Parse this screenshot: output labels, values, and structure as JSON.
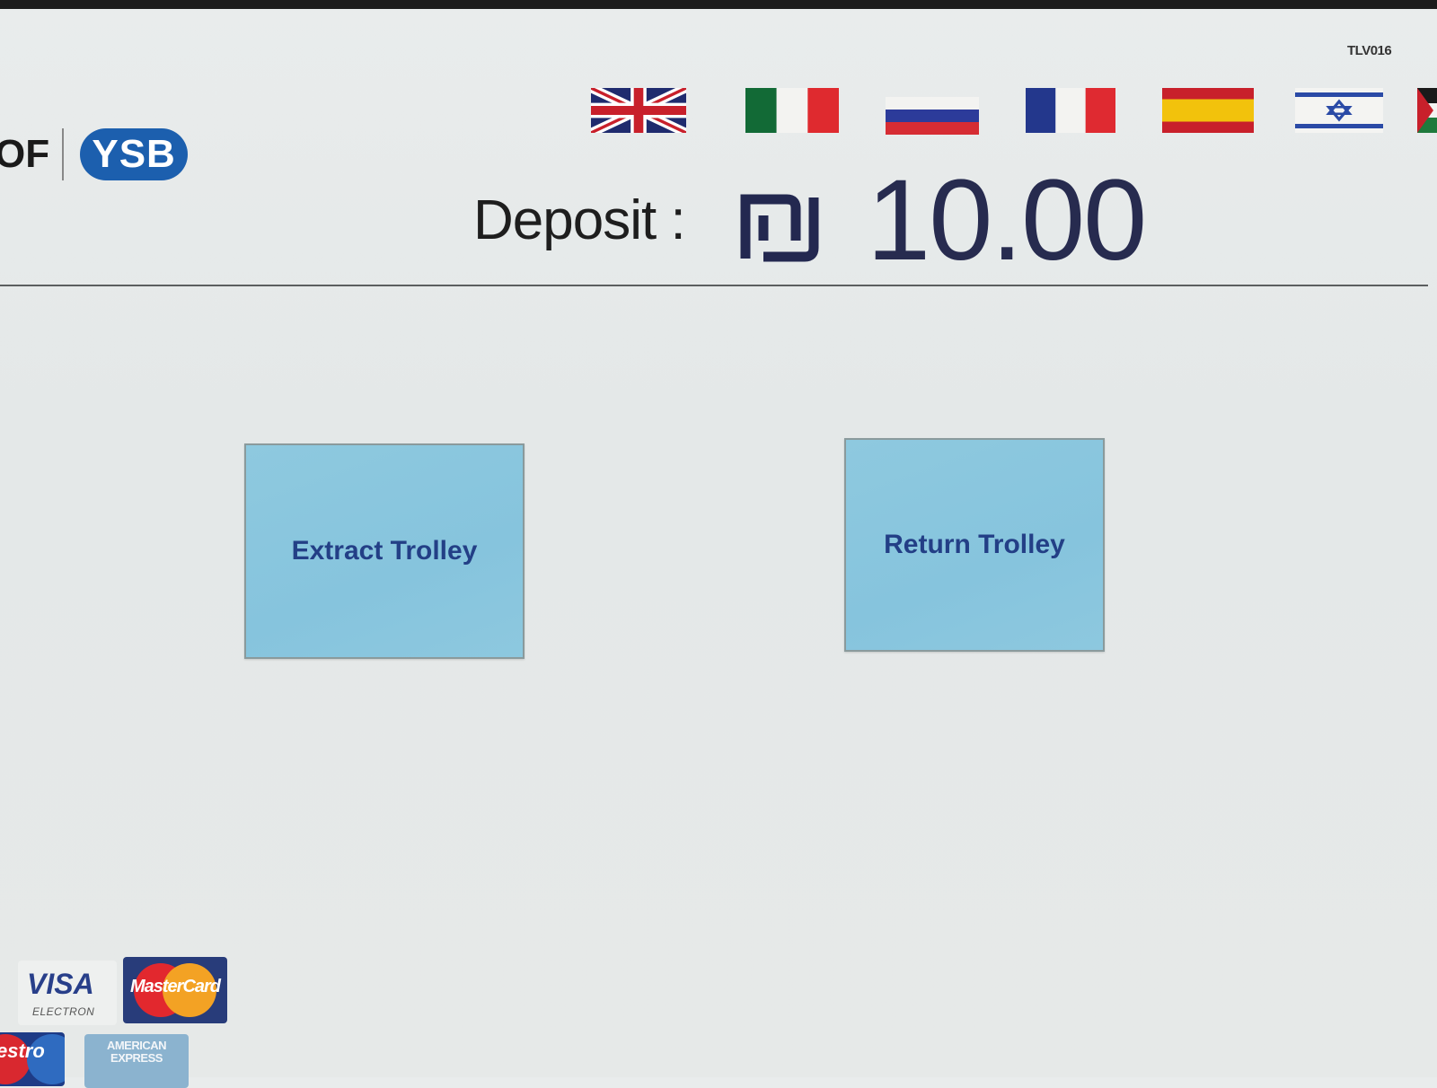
{
  "terminal_id": "TLV016",
  "brand": {
    "logo_text": "OF",
    "badge": "YSB"
  },
  "languages": [
    {
      "code": "en",
      "flag": "uk-flag-icon"
    },
    {
      "code": "it",
      "flag": "italy-flag-icon"
    },
    {
      "code": "ru",
      "flag": "russia-flag-icon"
    },
    {
      "code": "fr",
      "flag": "france-flag-icon"
    },
    {
      "code": "es",
      "flag": "spain-flag-icon"
    },
    {
      "code": "he",
      "flag": "israel-flag-icon"
    },
    {
      "code": "ar",
      "flag": "jordan-flag-icon"
    }
  ],
  "deposit": {
    "label": "Deposit :",
    "currency_symbol": "₪",
    "amount": "10.00"
  },
  "actions": {
    "extract": "Extract Trolley",
    "return": "Return Trolley"
  },
  "payment_cards": {
    "visa": "VISA",
    "visa_sub": "ELECTRON",
    "mastercard": "MasterCard",
    "maestro": "estro",
    "amex": "AMERICAN EXPRESS"
  },
  "colors": {
    "background": "#e7eaea",
    "button_fill": "#8ac7de",
    "button_text": "#233f86",
    "amount_text": "#272b4f",
    "badge": "#1c5fae"
  }
}
